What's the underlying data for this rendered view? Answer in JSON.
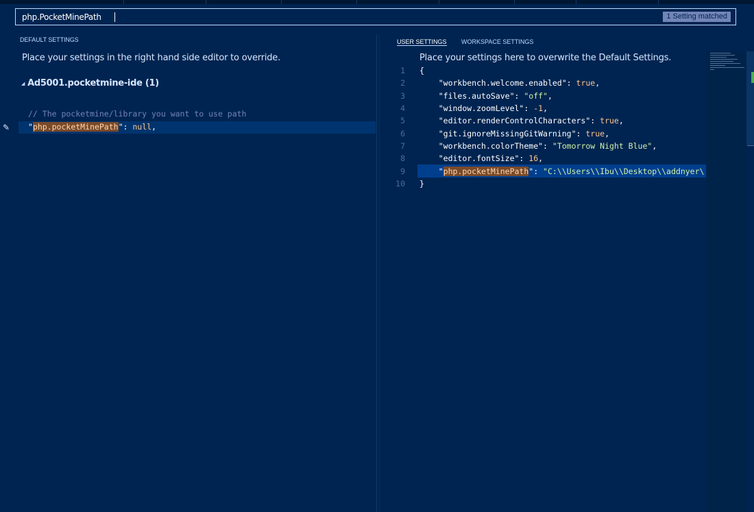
{
  "search": {
    "value": "php.PocketMinePath",
    "match_badge": "1 Setting matched"
  },
  "default_settings": {
    "title": "DEFAULT SETTINGS",
    "hint": "Place your settings in the right hand side editor to override.",
    "group_label": "Ad5001.pocketmine-ide (1)",
    "comment": "// The pocketmine/library you want to use path",
    "setting_key": "php.pocketMinePath",
    "setting_value": "null"
  },
  "user_settings": {
    "tabs": [
      {
        "label": "USER SETTINGS",
        "active": true
      },
      {
        "label": "WORKSPACE SETTINGS",
        "active": false
      }
    ],
    "hint": "Place your settings here to overwrite the Default Settings.",
    "line_numbers": [
      "1",
      "2",
      "3",
      "4",
      "5",
      "6",
      "7",
      "8",
      "9",
      "10"
    ],
    "lines": [
      {
        "key": "workbench.welcome.enabled",
        "value": "true"
      },
      {
        "key": "files.autoSave",
        "value": "\"off\""
      },
      {
        "key": "window.zoomLevel",
        "value": "-1"
      },
      {
        "key": "editor.renderControlCharacters",
        "value": "true"
      },
      {
        "key": "git.ignoreMissingGitWarning",
        "value": "true"
      },
      {
        "key": "workbench.colorTheme",
        "value": "\"Tomorrow Night Blue\""
      },
      {
        "key": "editor.fontSize",
        "value": "16"
      },
      {
        "key": "php.pocketMinePath",
        "value": "\"C:\\\\Users\\\\Ibu\\\\Desktop\\\\addnyer\\"
      }
    ]
  },
  "colors": {
    "background": "#002451",
    "highlight": "#7a4a2a",
    "accent": "#bbdaff"
  }
}
